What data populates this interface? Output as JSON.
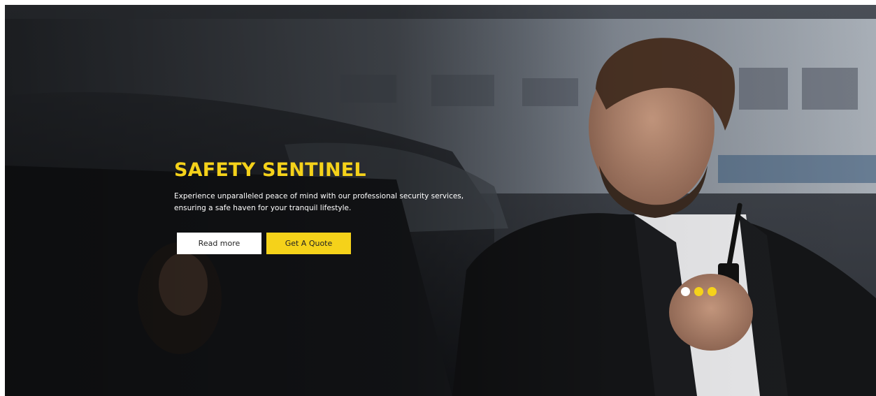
{
  "hero": {
    "title": "SAFETY SENTINEL",
    "description": "Experience unparalleled peace of mind with our professional security services, ensuring a safe haven for your tranquil lifestyle.",
    "read_more_label": "Read more",
    "quote_label": "Get A Quote"
  },
  "slider": {
    "dots": [
      {
        "active": true
      },
      {
        "active": false
      },
      {
        "active": false
      }
    ]
  },
  "colors": {
    "accent": "#f5d21a",
    "dot_active": "#ffffff",
    "dot_inactive": "#f5d21a",
    "button_light": "#ffffff"
  }
}
